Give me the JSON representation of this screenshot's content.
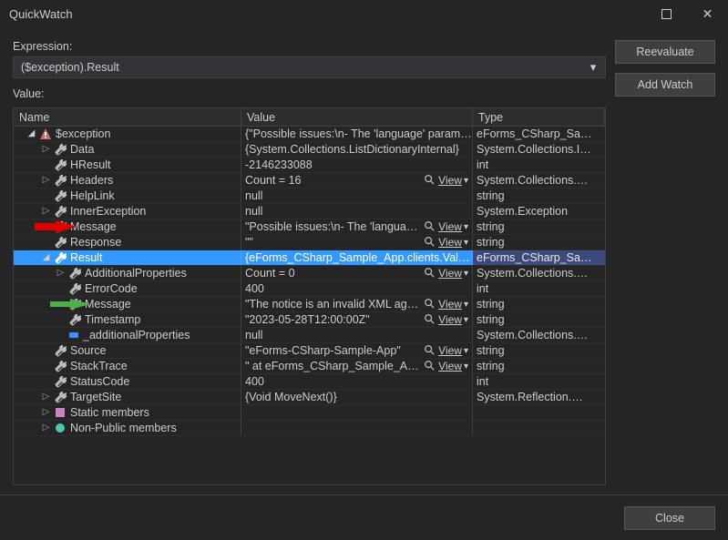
{
  "window": {
    "title": "QuickWatch"
  },
  "buttons": {
    "reevaluate": "Reevaluate",
    "add_watch": "Add Watch",
    "close": "Close"
  },
  "labels": {
    "expression": "Expression:",
    "value": "Value:"
  },
  "expression": {
    "text": "($exception).Result"
  },
  "columns": {
    "name": "Name",
    "value": "Value",
    "type": "Type"
  },
  "view": {
    "label": "View",
    "caret": "▾"
  },
  "rows": [
    {
      "depth": 0,
      "exp": "open",
      "icon": "exception",
      "name": "$exception",
      "value": "{\"Possible issues:\\n- The 'language' parameter is not valid.\\n- The …",
      "type": "eForms_CSharp_Sa…",
      "mag": false
    },
    {
      "depth": 1,
      "exp": "closed",
      "icon": "wrench",
      "name": "Data",
      "value": "{System.Collections.ListDictionaryInternal}",
      "type": "System.Collections.I…",
      "mag": false
    },
    {
      "depth": 1,
      "exp": "none",
      "icon": "wrench",
      "name": "HResult",
      "value": "-2146233088",
      "type": "int",
      "mag": false
    },
    {
      "depth": 1,
      "exp": "closed",
      "icon": "wrench",
      "name": "Headers",
      "value": "Count = 16",
      "type": "System.Collections.…",
      "mag": true
    },
    {
      "depth": 1,
      "exp": "none",
      "icon": "wrench",
      "name": "HelpLink",
      "value": "null",
      "type": "string",
      "mag": false
    },
    {
      "depth": 1,
      "exp": "closed",
      "icon": "wrench",
      "name": "InnerException",
      "value": "null",
      "type": "System.Exception",
      "mag": false
    },
    {
      "depth": 1,
      "exp": "none",
      "icon": "wrench",
      "name": "Message",
      "value": "\"Possible issues:\\n- The 'language' parameter is not vali…",
      "type": "string",
      "mag": true,
      "arrow": "red"
    },
    {
      "depth": 1,
      "exp": "none",
      "icon": "wrench",
      "name": "Response",
      "value": "\"\"",
      "type": "string",
      "mag": true
    },
    {
      "depth": 1,
      "exp": "open",
      "icon": "wrench",
      "name": "Result",
      "value": "{eForms_CSharp_Sample_App.clients.ValidationApi.ErrorResponse}",
      "type": "eForms_CSharp_Sa…",
      "mag": false,
      "selected": true
    },
    {
      "depth": 2,
      "exp": "closed",
      "icon": "wrench",
      "name": "AdditionalProperties",
      "value": "Count = 0",
      "type": "System.Collections.…",
      "mag": true
    },
    {
      "depth": 2,
      "exp": "none",
      "icon": "wrench",
      "name": "ErrorCode",
      "value": "400",
      "type": "int",
      "mag": false
    },
    {
      "depth": 2,
      "exp": "none",
      "icon": "wrench",
      "name": "Message",
      "value": "\"The notice is an invalid XML against its XSD. See below…",
      "type": "string",
      "mag": true,
      "arrow": "green"
    },
    {
      "depth": 2,
      "exp": "none",
      "icon": "wrench",
      "name": "Timestamp",
      "value": "\"2023-05-28T12:00:00Z\"",
      "type": "string",
      "mag": true
    },
    {
      "depth": 2,
      "exp": "none",
      "icon": "field",
      "name": "_additionalProperties",
      "value": "null",
      "type": "System.Collections.…",
      "mag": false
    },
    {
      "depth": 1,
      "exp": "none",
      "icon": "wrench",
      "name": "Source",
      "value": "\"eForms-CSharp-Sample-App\"",
      "type": "string",
      "mag": true
    },
    {
      "depth": 1,
      "exp": "none",
      "icon": "wrench",
      "name": "StackTrace",
      "value": "\"   at eForms_CSharp_Sample_App.clients.ValidationApi…",
      "type": "string",
      "mag": true
    },
    {
      "depth": 1,
      "exp": "none",
      "icon": "wrench",
      "name": "StatusCode",
      "value": "400",
      "type": "int",
      "mag": false
    },
    {
      "depth": 1,
      "exp": "closed",
      "icon": "wrench",
      "name": "TargetSite",
      "value": "{Void MoveNext()}",
      "type": "System.Reflection.…",
      "mag": false
    },
    {
      "depth": 1,
      "exp": "closed",
      "icon": "static",
      "name": "Static members",
      "value": "",
      "type": "",
      "mag": false
    },
    {
      "depth": 1,
      "exp": "closed",
      "icon": "nonpublic",
      "name": "Non-Public members",
      "value": "",
      "type": "",
      "mag": false
    }
  ]
}
